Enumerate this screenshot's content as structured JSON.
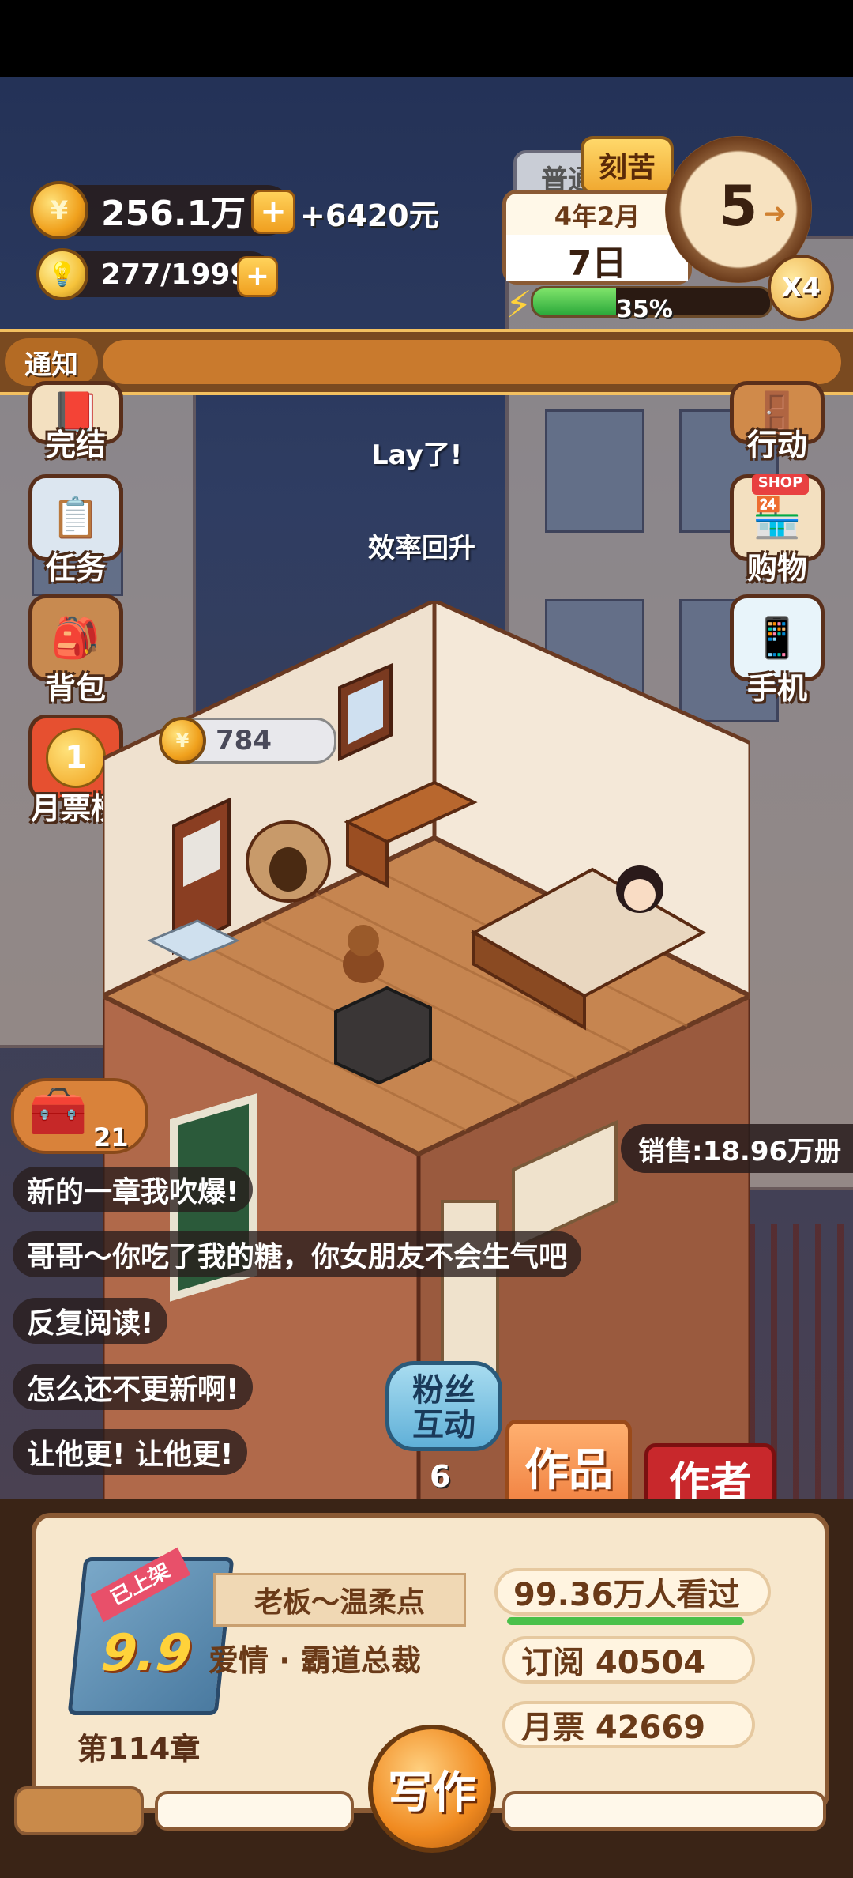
{
  "currency": {
    "coins": "256.1万",
    "income": "+6420元",
    "energy": "277/1999",
    "plus_symbol": "+"
  },
  "calendar": {
    "mode_normal": "普通",
    "mode_hard": "刻苦",
    "year_month": "4年2月",
    "day": "7日",
    "stamina_percent": "35%",
    "stamina_fraction": 0.35
  },
  "timer": {
    "value": "5",
    "speed": "X4"
  },
  "notice": {
    "label": "通知"
  },
  "left_menu": [
    {
      "label": "完结",
      "icon": "book-icon"
    },
    {
      "label": "任务",
      "icon": "checklist-icon"
    },
    {
      "label": "背包",
      "icon": "backpack-icon"
    },
    {
      "label": "月票榜",
      "icon": "ticket-coin-icon"
    }
  ],
  "right_menu": [
    {
      "label": "行动",
      "icon": "door-icon"
    },
    {
      "label": "购物",
      "icon": "shop-icon",
      "badge": "SHOP"
    },
    {
      "label": "手机",
      "icon": "phone-icon"
    }
  ],
  "floating": {
    "msg1": "Lay了!",
    "msg2": "效率回升"
  },
  "room": {
    "coin_bubble": "784"
  },
  "treasure": {
    "count": "21"
  },
  "sales": {
    "text": "销售:18.96万册"
  },
  "chat": [
    "新的一章我吹爆!",
    "哥哥～你吃了我的糖，你女朋友不会生气吧",
    "反复阅读!",
    "怎么还不更新啊!",
    "让他更! 让他更!"
  ],
  "fan": {
    "label_line1": "粉丝",
    "label_line2": "互动",
    "count": "6"
  },
  "tabs": {
    "works": "作品",
    "author": "作者"
  },
  "book": {
    "tag": "已上架",
    "rating": "9.9",
    "title": "老板～温柔点",
    "genre": "爱情 · 霸道总裁",
    "chapter": "第114章",
    "views": "99.36万人看过",
    "subscribe": "订阅 40504",
    "monthly": "月票 42669",
    "write_button": "写作"
  },
  "colors": {
    "accent_orange": "#c97a2d",
    "gold": "#f0a020",
    "panel_brown": "#3a2416",
    "cream": "#f7e7cc",
    "author_red": "#c8282c"
  }
}
